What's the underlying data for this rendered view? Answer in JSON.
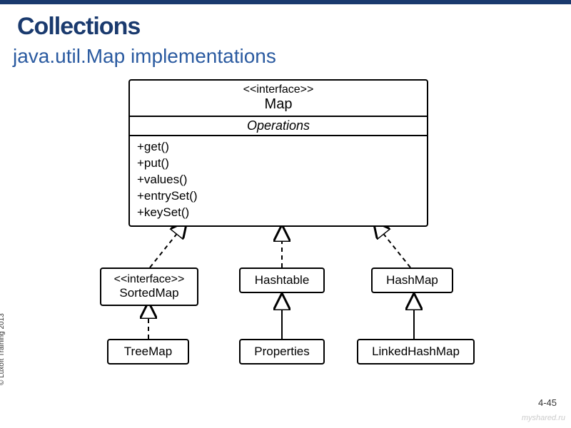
{
  "title": "Collections",
  "subtitle": "java.util.Map implementations",
  "map_box": {
    "stereotype": "<<interface>>",
    "name": "Map",
    "section_label": "Operations",
    "ops": [
      "+get()",
      "+put()",
      "+values()",
      "+entrySet()",
      "+keySet()"
    ]
  },
  "row2": {
    "sortedmap": {
      "stereotype": "<<interface>>",
      "name": "SortedMap"
    },
    "hashtable": {
      "name": "Hashtable"
    },
    "hashmap": {
      "name": "HashMap"
    }
  },
  "row3": {
    "treemap": {
      "name": "TreeMap"
    },
    "properties": {
      "name": "Properties"
    },
    "linkedhashmap": {
      "name": "LinkedHashMap"
    }
  },
  "copyright": "© Luxoft Training 2013",
  "watermark": "myshared.ru",
  "pagenum": "4-45"
}
